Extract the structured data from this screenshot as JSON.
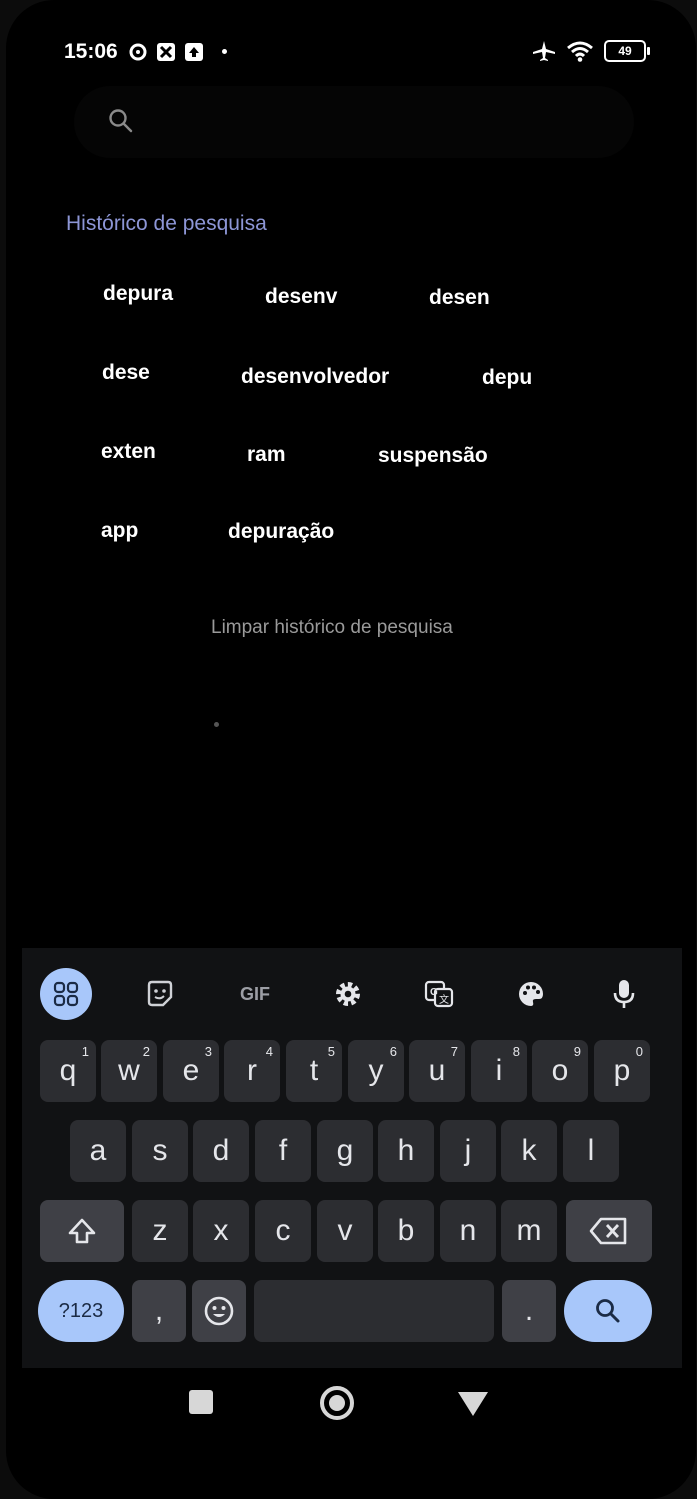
{
  "status": {
    "time": "15:06",
    "battery": "49"
  },
  "search": {
    "placeholder": ""
  },
  "history": {
    "title": "Histórico de pesquisa",
    "items": [
      "depura",
      "desenv",
      "desen",
      "dese",
      "desenvolvedor",
      "depu",
      "exten",
      "ram",
      "suspensão",
      "app",
      "depuração"
    ],
    "clear_label": "Limpar histórico de pesquisa"
  },
  "keyboard": {
    "toolbar": {
      "gif": "GIF"
    },
    "row1": [
      {
        "k": "q",
        "n": "1"
      },
      {
        "k": "w",
        "n": "2"
      },
      {
        "k": "e",
        "n": "3"
      },
      {
        "k": "r",
        "n": "4"
      },
      {
        "k": "t",
        "n": "5"
      },
      {
        "k": "y",
        "n": "6"
      },
      {
        "k": "u",
        "n": "7"
      },
      {
        "k": "i",
        "n": "8"
      },
      {
        "k": "o",
        "n": "9"
      },
      {
        "k": "p",
        "n": "0"
      }
    ],
    "row2": [
      "a",
      "s",
      "d",
      "f",
      "g",
      "h",
      "j",
      "k",
      "l"
    ],
    "row3": [
      "z",
      "x",
      "c",
      "v",
      "b",
      "n",
      "m"
    ],
    "symbols_label": "?123",
    "comma": ",",
    "period": "."
  }
}
